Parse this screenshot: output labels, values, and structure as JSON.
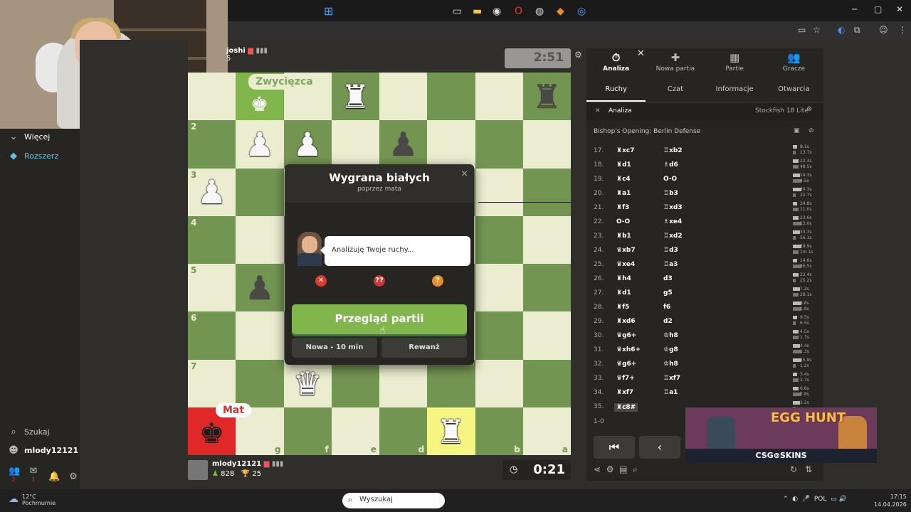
{
  "browser": {
    "minimize": "─",
    "maximize": "▢",
    "close": "✕"
  },
  "sidebar": {
    "more_label": "Więcej",
    "extensions_label": "Rozszerz",
    "search_label": "Szukaj",
    "user_label": "mlody12121",
    "notif_badge_1": "2",
    "notif_badge_2": "1"
  },
  "opponent": {
    "name": "joshi",
    "rating_fragment": "5",
    "clock": "2:51"
  },
  "player": {
    "name": "mlody12121",
    "rating": "828",
    "trophies": "25",
    "clock": "0:21"
  },
  "board": {
    "winner_badge": "Zwycięzca",
    "mate_badge": "Mat",
    "ranks": [
      "2",
      "3",
      "4",
      "5",
      "6",
      "7"
    ],
    "files": [
      "g",
      "f",
      "e",
      "d",
      "c",
      "b",
      "a"
    ]
  },
  "modal": {
    "title": "Wygrana białych",
    "subtitle": "poprzez mata",
    "coach_text": "Analizuję Twoje ruchy...",
    "review_button": "Przegląd partii",
    "new_game_button": "Nowa - 10 min",
    "rematch_button": "Rewanż",
    "close": "×"
  },
  "panel": {
    "tabs": [
      {
        "label": "Analiza",
        "icon": "⏱"
      },
      {
        "label": "Nowa partia",
        "icon": "✚"
      },
      {
        "label": "Partie",
        "icon": "▦"
      },
      {
        "label": "Gracze",
        "icon": "👥"
      }
    ],
    "subtabs": [
      "Ruchy",
      "Czat",
      "Informacje",
      "Otwarcia"
    ],
    "engine_label": "Analiza",
    "engine_name": "Stockfish 18 Lite",
    "opening": "Bishop's Opening: Berlin Defense",
    "result": "1-0",
    "moves": [
      {
        "n": "17.",
        "w": "♜xc7",
        "b": "♖xb2",
        "t1": "8.1s",
        "t2": "13.7s"
      },
      {
        "n": "18.",
        "w": "♜d1",
        "b": "♗d6",
        "t1": "22.3s",
        "t2": "48.5s"
      },
      {
        "n": "19.",
        "w": "♜c4",
        "b": "O-O",
        "t1": "24.3s",
        "t2": "4.5s"
      },
      {
        "n": "20.",
        "w": "♜a1",
        "b": "♖b3",
        "t1": "20.3s",
        "t2": "22.7s"
      },
      {
        "n": "21.",
        "w": "♜f3",
        "b": "♖xd3",
        "t1": "24.8s",
        "t2": "11.0s"
      },
      {
        "n": "22.",
        "w": "O-O",
        "b": "♗xe4",
        "t1": "23.6s",
        "t2": "13.0s"
      },
      {
        "n": "23.",
        "w": "♜b1",
        "b": "♖xd2",
        "t1": "33.3s",
        "t2": "56.1s"
      },
      {
        "n": "24.",
        "w": "♛xb7",
        "b": "♖d3",
        "t1": "29.9s",
        "t2": "1m 1s"
      },
      {
        "n": "25.",
        "w": "♛xe4",
        "b": "♖a3",
        "t1": "14.6s",
        "t2": "36.5s"
      },
      {
        "n": "26.",
        "w": "♜h4",
        "b": "d3",
        "t1": "22.4s",
        "t2": "25.2s"
      },
      {
        "n": "27.",
        "w": "♜d1",
        "b": "g5",
        "t1": "7.2s",
        "t2": "28.1s"
      },
      {
        "n": "28.",
        "w": "♜f5",
        "b": "f6",
        "t1": "8.8s",
        "t2": "1.8s"
      },
      {
        "n": "29.",
        "w": "♜xd6",
        "b": "d2",
        "t1": "9.5s",
        "t2": "6.5s"
      },
      {
        "n": "30.",
        "w": "♛g6+",
        "b": "♔h8",
        "t1": "4.5s",
        "t2": "1.7s"
      },
      {
        "n": "31.",
        "w": "♛xh6+",
        "b": "♔g8",
        "t1": "4.4s",
        "t2": "1.3s"
      },
      {
        "n": "32.",
        "w": "♛g6+",
        "b": "♔h8",
        "t1": "15.9s",
        "t2": "1.2s"
      },
      {
        "n": "33.",
        "w": "♛f7+",
        "b": "♖xf7",
        "t1": "3.4s",
        "t2": "2.7s"
      },
      {
        "n": "34.",
        "w": "♜xf7",
        "b": "♖a1",
        "t1": "6.8s",
        "t2": "7.8s"
      },
      {
        "n": "35.",
        "w": "♜c8#",
        "b": "",
        "t1": "3.2s",
        "t2": ""
      }
    ]
  },
  "ad": {
    "title": "EGG HUNT",
    "brand": "CSG⊚SKINS"
  },
  "taskbar": {
    "temperature": "12°C",
    "weather": "Pochmurnie",
    "search_placeholder": "Wyszukaj",
    "language": "POL",
    "time": "17:15",
    "date": "14.04.2026"
  }
}
